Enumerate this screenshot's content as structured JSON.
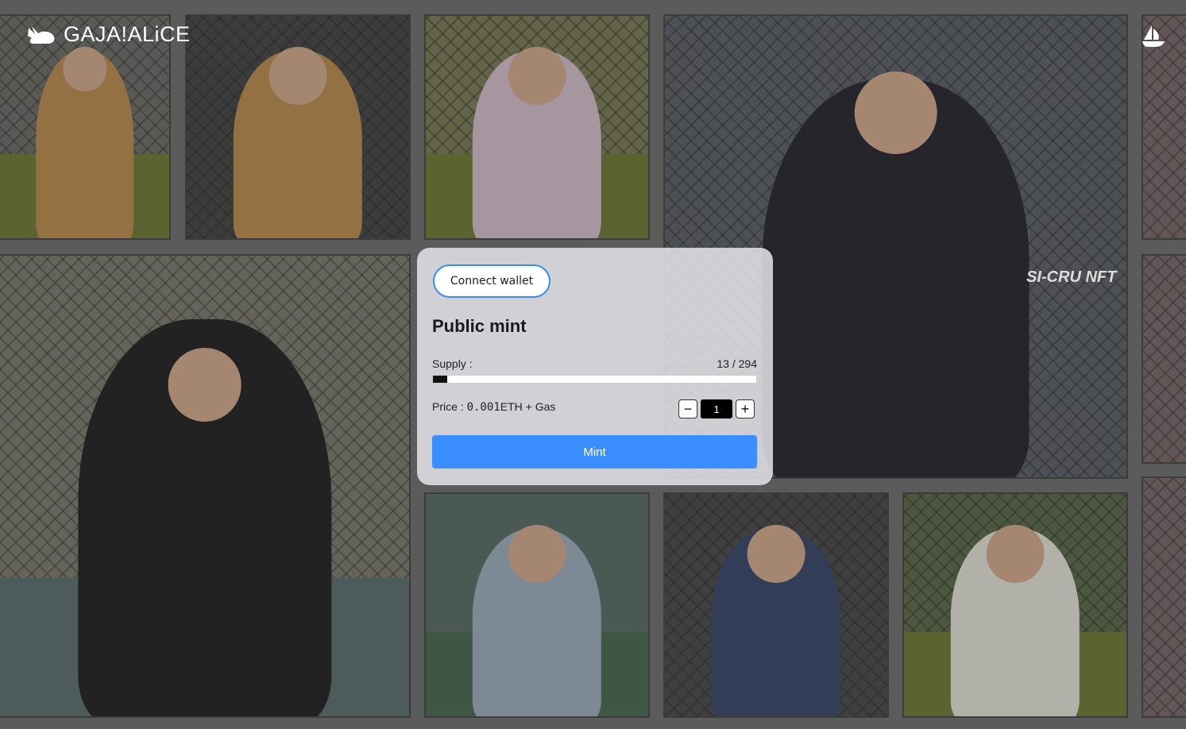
{
  "brand": {
    "logo_text": "GAJA!ALiCE",
    "logo_icon": "rabbit-icon",
    "marketplace_icon": "opensea-icon"
  },
  "mint_panel": {
    "connect_label": "Connect wallet",
    "title": "Public mint",
    "supply_label": "Supply :",
    "supply_count": "13 / 294",
    "supply_fraction": 0.044,
    "price_prefix": "Price : ",
    "price_amount": "0.001",
    "price_suffix": "ETH + Gas",
    "decrement_symbol": "−",
    "increment_symbol": "+",
    "quantity_value": "1",
    "mint_label": "Mint"
  },
  "gallery": {
    "overlay_text": "SI-CRU NFT",
    "tiles": [
      {
        "name": "tile-cyborg-girl",
        "bg": "#6d6d68",
        "figure": "#b58a52"
      },
      {
        "name": "tile-cyborg-girl-bunny",
        "bg": "#4a4a4a",
        "figure": "#b58a52"
      },
      {
        "name": "tile-cat-hoodie",
        "bg": "#7a7a5a",
        "figure": "#cbb7c4"
      },
      {
        "name": "tile-gym-girl",
        "bg": "#5e6368",
        "figure": "#2e2e35"
      },
      {
        "name": "tile-mad-hatter",
        "bg": "#7c7a70",
        "figure": "#2a2a2a"
      },
      {
        "name": "tile-tennis-girl",
        "bg": "#5b6d66",
        "figure": "#9aa8b8"
      },
      {
        "name": "tile-alice-maid",
        "bg": "#4e4e4e",
        "figure": "#3e4b6b"
      },
      {
        "name": "tile-sunhat-girl",
        "bg": "#5f6b4d",
        "figure": "#d8d8d0"
      },
      {
        "name": "tile-edge-top",
        "bg": "#7a6a6a",
        "figure": "#8a7070"
      },
      {
        "name": "tile-edge-mid",
        "bg": "#7a6a6a",
        "figure": "#8a7070"
      },
      {
        "name": "tile-edge-bottom",
        "bg": "#7a6a6a",
        "figure": "#8a7070"
      }
    ]
  }
}
